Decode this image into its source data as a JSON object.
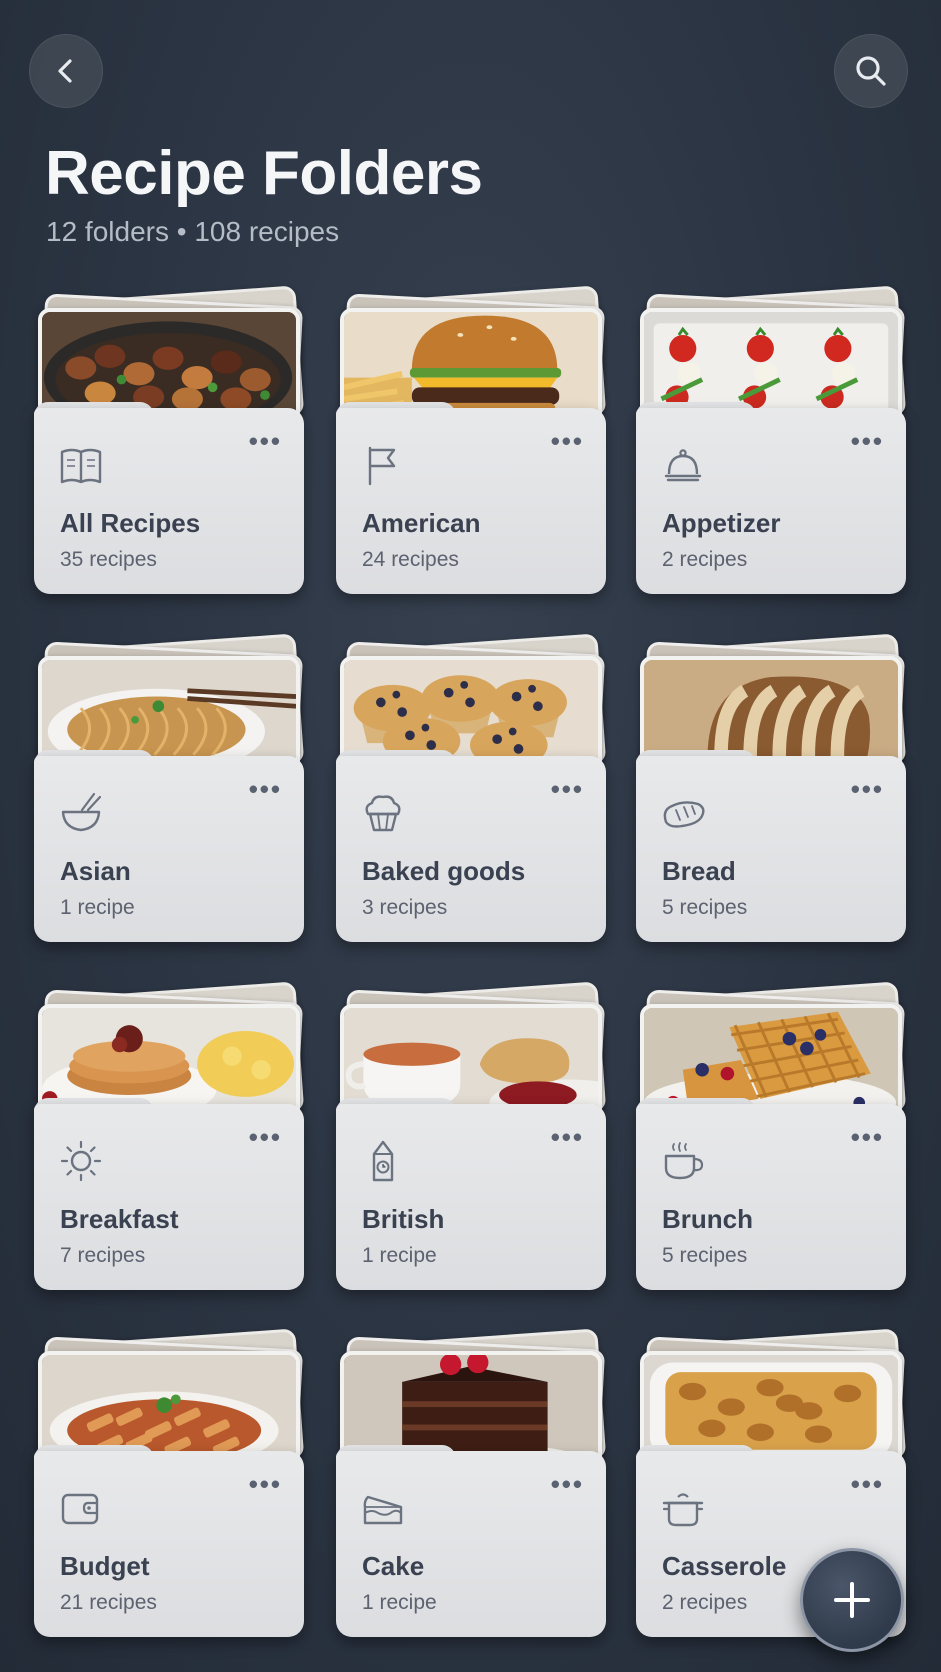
{
  "header": {
    "title": "Recipe Folders",
    "subtitle": "12 folders • 108 recipes",
    "back_icon": "chevron-left-icon",
    "search_icon": "search-icon"
  },
  "folders": [
    {
      "name": "All Recipes",
      "count": "35 recipes",
      "icon": "book-icon",
      "photo": "stir-fry"
    },
    {
      "name": "American",
      "count": "24 recipes",
      "icon": "flag-icon",
      "photo": "burger"
    },
    {
      "name": "Appetizer",
      "count": "2 recipes",
      "icon": "cloche-icon",
      "photo": "skewers"
    },
    {
      "name": "Asian",
      "count": "1 recipe",
      "icon": "bowl-chopsticks-icon",
      "photo": "noodles"
    },
    {
      "name": "Baked goods",
      "count": "3 recipes",
      "icon": "muffin-icon",
      "photo": "muffins"
    },
    {
      "name": "Bread",
      "count": "5 recipes",
      "icon": "bread-icon",
      "photo": "bread-loaf"
    },
    {
      "name": "Breakfast",
      "count": "7 recipes",
      "icon": "sun-icon",
      "photo": "pancakes"
    },
    {
      "name": "British",
      "count": "1 recipe",
      "icon": "clock-tower-icon",
      "photo": "tea-scone"
    },
    {
      "name": "Brunch",
      "count": "5 recipes",
      "icon": "coffee-cup-icon",
      "photo": "waffles"
    },
    {
      "name": "Budget",
      "count": "21 recipes",
      "icon": "wallet-icon",
      "photo": "pasta"
    },
    {
      "name": "Cake",
      "count": "1 recipe",
      "icon": "cake-slice-icon",
      "photo": "chocolate-cake"
    },
    {
      "name": "Casserole",
      "count": "2 recipes",
      "icon": "pot-icon",
      "photo": "casserole"
    }
  ],
  "more_label": "•••",
  "fab": {
    "icon": "plus-icon"
  }
}
